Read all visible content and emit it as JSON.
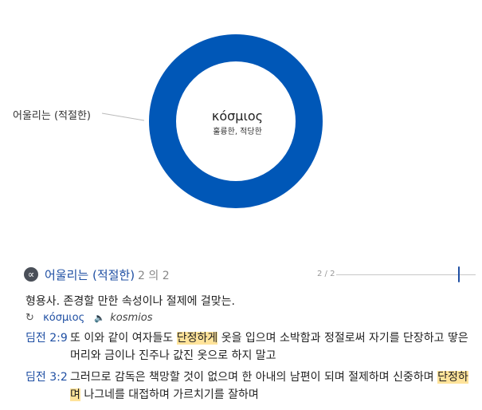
{
  "chart": {
    "center_title": "κόσμιος",
    "center_subtitle": "훌륭한, 적당한",
    "ring_color": "#0057b7",
    "slices": [
      {
        "label": "어울리는 (적절한)",
        "value": 2
      }
    ]
  },
  "sense": {
    "icon": "alpha-omega-icon",
    "title": "어울리는 (적절한)",
    "count_text": "2 의 2",
    "pager_text": "2 / 2",
    "definition": "형용사. 존경할 만한 속성이나 절제에 걸맞는.",
    "lemma_greek": "κόσμιος",
    "lemma_translit": "kosmios",
    "refresh_icon": "refresh-icon",
    "audio_icon": "speaker-icon"
  },
  "verses": [
    {
      "ref": "딤전 2:9",
      "before": "또 이와 같이 여자들도 ",
      "highlight": "단정하게",
      "after": " 옷을 입으며 소박함과 정절로써 자기를 단장하고 땋은 머리와 금이나 진주나 값진 옷으로 하지 말고"
    },
    {
      "ref": "딤전 3:2",
      "before": "그러므로 감독은 책망할 것이 없으며 한 아내의 남편이 되며 절제하며 신중하며 ",
      "highlight": "단정하며",
      "after": " 나그네를 대접하며 가르치기를 잘하며"
    }
  ]
}
